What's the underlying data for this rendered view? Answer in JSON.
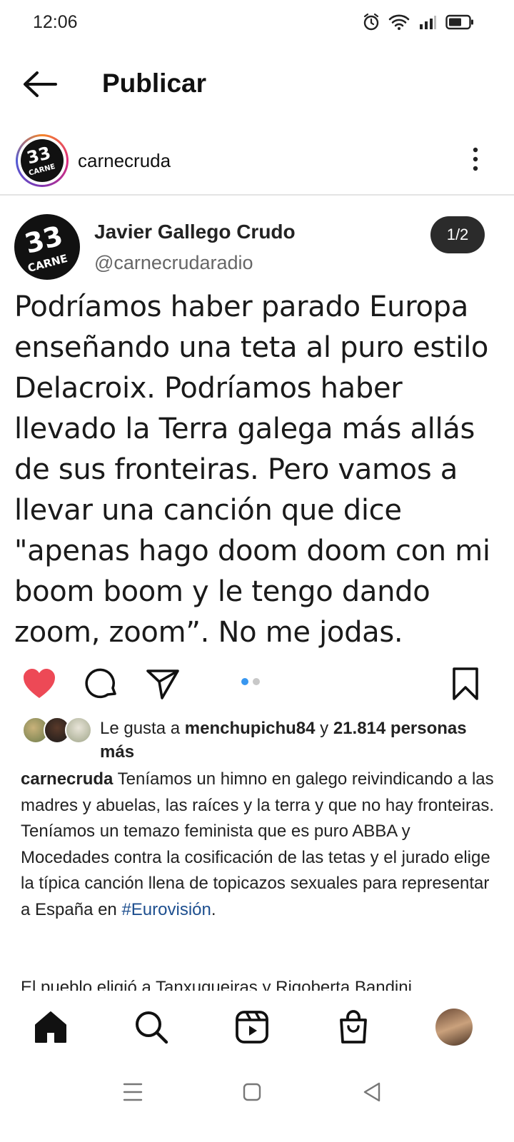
{
  "status_bar": {
    "time": "12:06",
    "icons": [
      "alarm-icon",
      "wifi-icon",
      "signal-icon",
      "battery-icon"
    ]
  },
  "header": {
    "title": "Publicar",
    "back_icon": "arrow-left-icon"
  },
  "account": {
    "username": "carnecruda",
    "logo_text": "CARNE CRUDA",
    "logo_number": "33"
  },
  "tweet": {
    "author": "Javier Gallego Crudo",
    "handle": "@carnecrudaradio",
    "counter": "1/2",
    "text": "Podríamos haber parado Europa enseñando una teta al puro estilo Delacroix. Podríamos haber llevado la Terra galega más allás de sus fronteiras. Pero vamos a llevar una canción que dice \"apenas hago doom doom con mi boom boom y le tengo dando zoom, zoom”. No me jodas."
  },
  "actions": {
    "like_icon": "heart-filled-icon",
    "comment_icon": "comment-icon",
    "share_icon": "send-icon",
    "save_icon": "bookmark-icon",
    "carousel_total": 2,
    "carousel_active": 1,
    "colors": {
      "heart": "#ed4956",
      "dot_active": "#3897f0",
      "dot_inactive": "#c8c8c8"
    }
  },
  "likes": {
    "prefix": "Le gusta a",
    "user": "menchupichu84",
    "connector": "y",
    "count": "21.814",
    "suffix": "personas más"
  },
  "caption": {
    "username": "carnecruda",
    "text": "Teníamos un himno en galego reivindicando a las madres y abuelas, las raíces y la terra y que no hay fronteiras. Teníamos un temazo feminista que es puro ABBA y Mocedades contra la cosificación de las tetas y el jurado elige la típica canción llena de topicazos sexuales para representar a España en",
    "hashtag": "#Eurovisión",
    "end": ".",
    "next_paragraph": "El pueblo eligió a Tanxugueiras y Rigoberta Bandini."
  },
  "bottom_nav": {
    "items": [
      "home-icon",
      "search-icon",
      "reels-icon",
      "shop-icon",
      "profile-avatar"
    ]
  },
  "system_nav": {
    "items": [
      "menu-icon",
      "home-square-icon",
      "back-triangle-icon"
    ]
  }
}
